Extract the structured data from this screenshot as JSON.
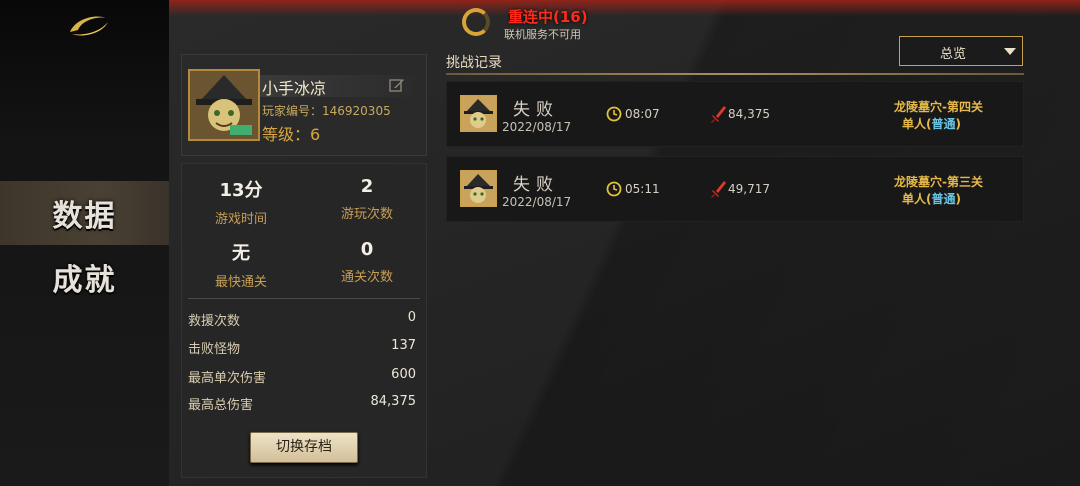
{
  "status": {
    "title": "重连中(16)",
    "subtitle": "联机服务不可用"
  },
  "sidebar": {
    "items": [
      {
        "label": "数据",
        "active": true
      },
      {
        "label": "成就",
        "active": false
      }
    ]
  },
  "profile": {
    "name": "小手冰凉",
    "player_id": "玩家编号：146920305",
    "level": "等级：6"
  },
  "stats": {
    "grid": [
      {
        "value": "13分",
        "label": "游戏时间"
      },
      {
        "value": "2",
        "label": "游玩次数"
      },
      {
        "value": "无",
        "label": "最快通关"
      },
      {
        "value": "0",
        "label": "通关次数"
      }
    ],
    "rows": [
      {
        "label": "救援次数",
        "value": "0"
      },
      {
        "label": "击败怪物",
        "value": "137"
      },
      {
        "label": "最高单次伤害",
        "value": "600"
      },
      {
        "label": "最高总伤害",
        "value": "84,375"
      }
    ],
    "switch_button": "切换存档"
  },
  "records": {
    "title": "挑战记录",
    "filter": "总览",
    "items": [
      {
        "result": "失败",
        "date": "2022/08/17",
        "time": "08:07",
        "damage": "84,375",
        "stage": "龙陵墓穴-第四关",
        "mode": "单人(",
        "difficulty": "普通",
        "mode_end": ")"
      },
      {
        "result": "失败",
        "date": "2022/08/17",
        "time": "05:11",
        "damage": "49,717",
        "stage": "龙陵墓穴-第三关",
        "mode": "单人(",
        "difficulty": "普通",
        "mode_end": ")"
      }
    ]
  },
  "colors": {
    "accent_gold": "#c9a14e",
    "status_red": "#ff2a1a",
    "difficulty_blue": "#67c6e4"
  }
}
